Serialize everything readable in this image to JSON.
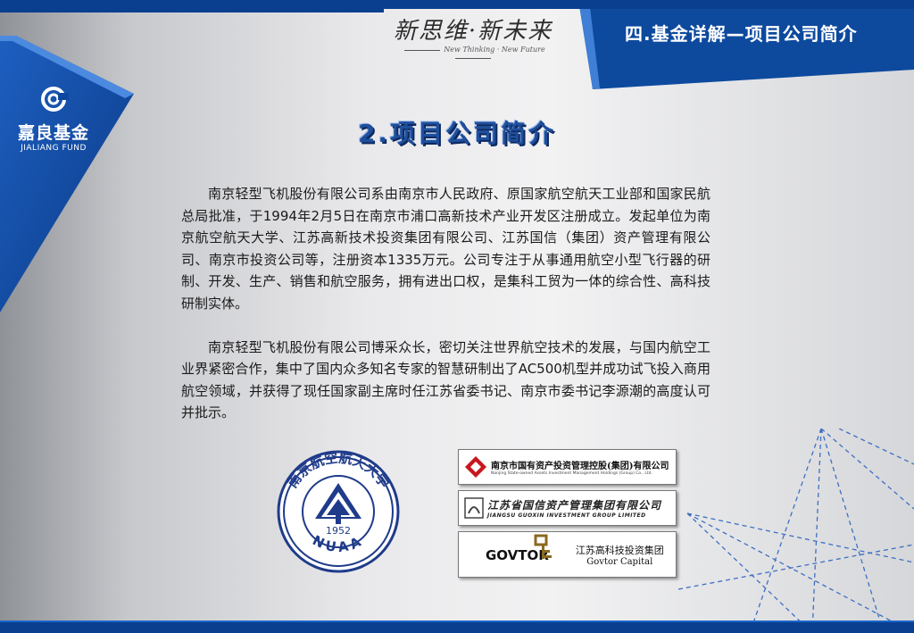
{
  "header": {
    "slogan_cn": "新思维·新未来",
    "slogan_en": "New Thinking · New Future",
    "section_title": "四.基金详解—项目公司简介"
  },
  "brand": {
    "name_cn": "嘉良基金",
    "name_en": "JIALIANG FUND"
  },
  "page_title": "2.项目公司简介",
  "paragraphs": [
    "南京轻型飞机股份有限公司系由南京市人民政府、原国家航空航天工业部和国家民航总局批准，于1994年2月5日在南京市浦口高新技术产业开发区注册成立。发起单位为南京航空航天大学、江苏高新技术投资集团有限公司、江苏国信（集团）资产管理有限公司、南京市投资公司等，注册资本1335万元。公司专注于从事通用航空小型飞行器的研制、开发、生产、销售和航空服务，拥有进出口权，是集科工贸为一体的综合性、高科技研制实体。",
    "南京轻型飞机股份有限公司博采众长，密切关注世界航空技术的发展，与国内航空工业界紧密合作，集中了国内众多知名专家的智慧研制出了AC500机型并成功试飞投入商用航空领域，并获得了现任国家副主席时任江苏省委书记、南京市委书记李源潮的高度认可并批示。"
  ],
  "nuaa_seal": {
    "ring_text": "南京航空航天大学",
    "year": "1952",
    "abbr": "NUAA"
  },
  "partners": [
    {
      "name_cn": "南京市国有资产投资管理控股(集团)有限公司",
      "name_en": "Nanjing State-owned Assets Investment Management Holdings (Group) Co., Ltd."
    },
    {
      "name_cn": "江苏省国信资产管理集团有限公司",
      "name_en": "JIANGSU GUOXIN INVESTMENT GROUP LIMITED"
    },
    {
      "brand": "GOVTOR",
      "name_cn": "江苏高科技投资集团",
      "name_en": "Govtor Capital"
    }
  ],
  "colors": {
    "primary_blue": "#0a3f8f",
    "accent_blue": "#1b64c8",
    "title_blue": "#1f4f9c",
    "seal_red": "#c8171e"
  }
}
